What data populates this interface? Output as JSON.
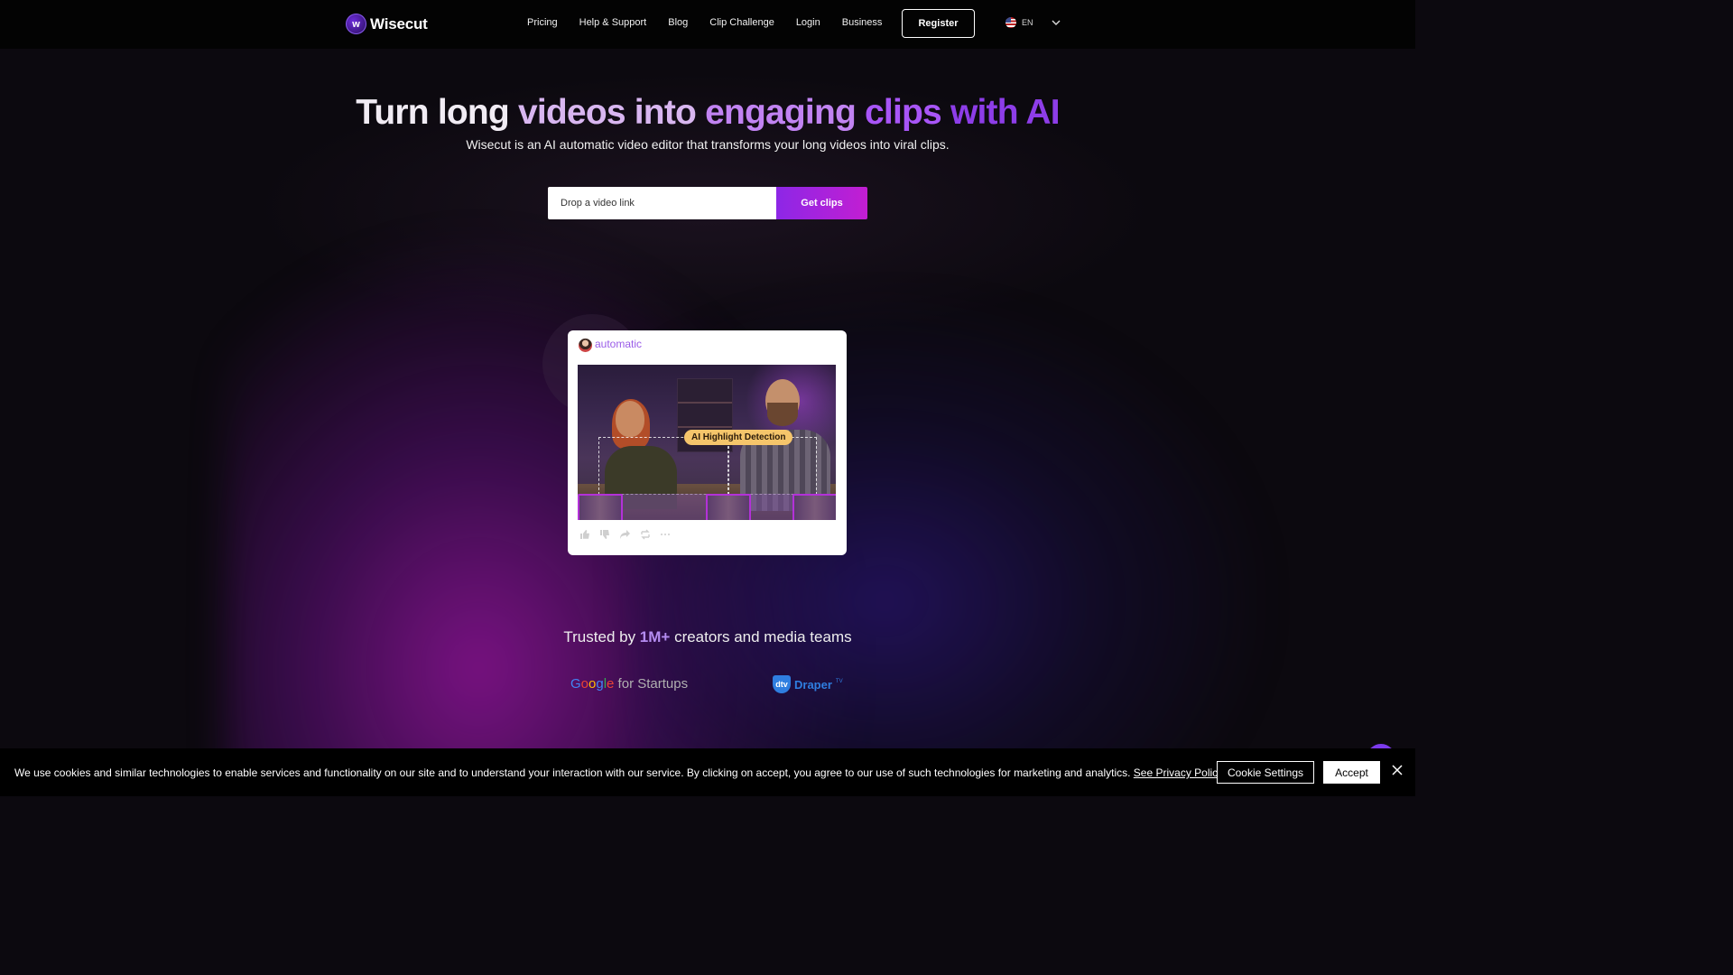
{
  "nav": {
    "logo_text": "Wisecut",
    "logo_mark": "w",
    "links": [
      "Pricing",
      "Help & Support",
      "Blog",
      "Clip Challenge",
      "Login",
      "Business"
    ],
    "register_label": "Register",
    "language": "EN",
    "language_icon": "us-flag-icon"
  },
  "hero": {
    "headline_parts": [
      "Turn long ",
      "videos into ",
      "engaging ",
      "clips ",
      "with AI"
    ],
    "subheadline": "Wisecut is an AI automatic video editor that transforms your long videos into viral clips.",
    "input_placeholder": "Drop a video link",
    "cta_label": "Get clips"
  },
  "demo_card": {
    "tag": "automatic",
    "badge": "AI Highlight Detection",
    "action_icons": [
      "thumbs-up-icon",
      "thumbs-down-icon",
      "share-icon",
      "remix-icon",
      "more-icon"
    ]
  },
  "trust": {
    "prefix": "Trusted by ",
    "highlight": "1M+",
    "suffix": " creators and media teams",
    "partner_google_letters": [
      "G",
      "o",
      "o",
      "g",
      "l",
      "e"
    ],
    "partner_google_rest": " for Startups",
    "partner_draper_mark": "dtv",
    "partner_draper": "Draper",
    "partner_draper_suffix": "TV"
  },
  "cookie": {
    "text": "We use cookies and similar technologies to enable services and functionality on our site and to understand your interaction with our service. By clicking on accept, you agree to our use of such technologies for marketing and analytics. ",
    "link": "See Privacy Policy",
    "settings_label": "Cookie Settings",
    "accept_label": "Accept"
  },
  "colors": {
    "background": "#0c090f",
    "accent_purple": "#a855f7",
    "cta_gradient_start": "#8d27e6",
    "cta_gradient_end": "#c21ed2",
    "badge_yellow": "#f5c56b"
  }
}
